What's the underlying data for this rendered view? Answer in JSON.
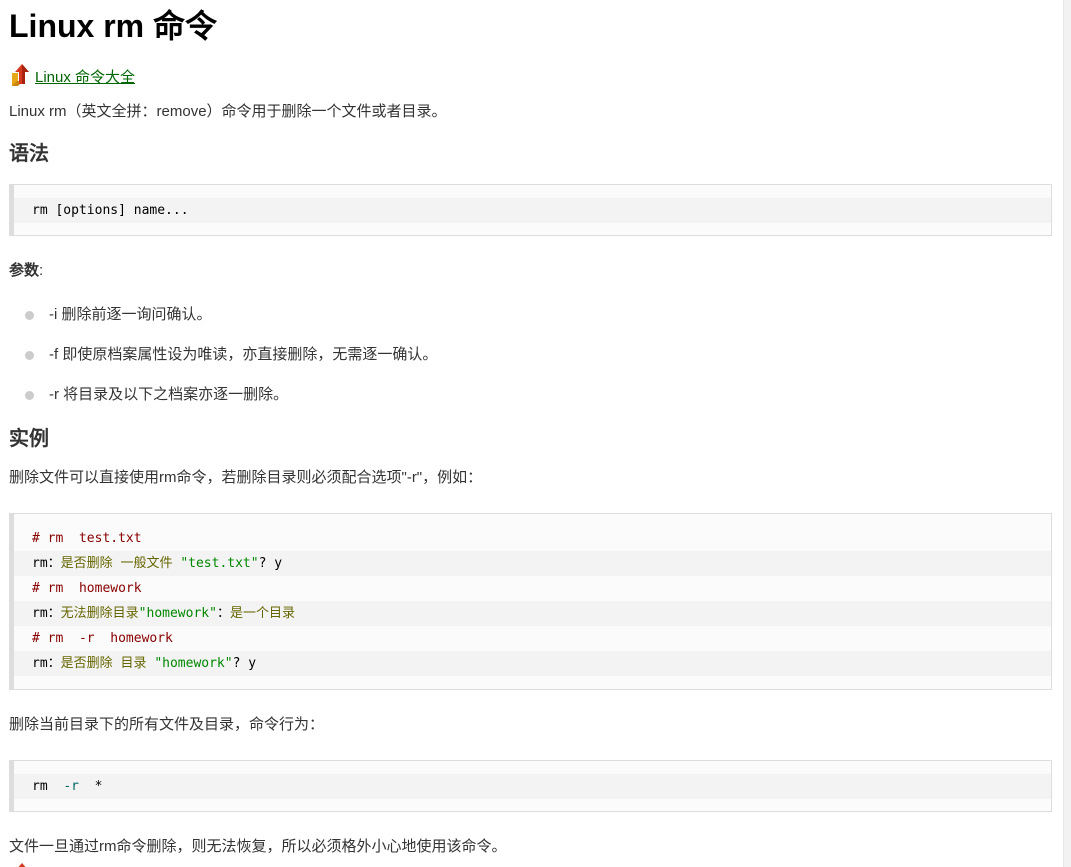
{
  "page": {
    "title": "Linux rm 命令",
    "back_link": "Linux 命令大全",
    "intro": "Linux rm（英文全拼：remove）命令用于删除一个文件或者目录。"
  },
  "syntax": {
    "heading": "语法",
    "code": "rm [options] name..."
  },
  "params": {
    "label": "参数",
    "colon": ":",
    "items": [
      "-i 删除前逐一询问确认。",
      "-f 即使原档案属性设为唯读，亦直接删除，无需逐一确认。",
      "-r 将目录及以下之档案亦逐一删除。"
    ]
  },
  "examples": {
    "heading": "实例",
    "desc1": "删除文件可以直接使用rm命令，若删除目录则必须配合选项\"-r\"，例如：",
    "code1": [
      {
        "c1": "# rm  test.txt"
      },
      {
        "c1": "rm：",
        "c2": "是否删除 一般文件 ",
        "c3": "\"test.txt\"",
        "c4": "? y"
      },
      {
        "c1": "# rm  homework"
      },
      {
        "c1": "rm：",
        "c2": "无法删除目录",
        "c3": "\"homework\"",
        "c4": "：",
        "c5": "是一个目录"
      },
      {
        "c1": "# rm  -r  homework"
      },
      {
        "c1": "rm：",
        "c2": "是否删除 目录 ",
        "c3": "\"homework\"",
        "c4": "? y"
      }
    ],
    "desc2": "删除当前目录下的所有文件及目录，命令行为：",
    "code2": {
      "cmd": "rm  ",
      "flag": "-r",
      "rest": "  *"
    },
    "desc3": "文件一旦通过rm命令删除，则无法恢复，所以必须格外小心地使用该命令。"
  },
  "colors": {
    "link": "#006600",
    "comment": "#880000",
    "string": "#008800",
    "code_border": "#dddddd"
  }
}
